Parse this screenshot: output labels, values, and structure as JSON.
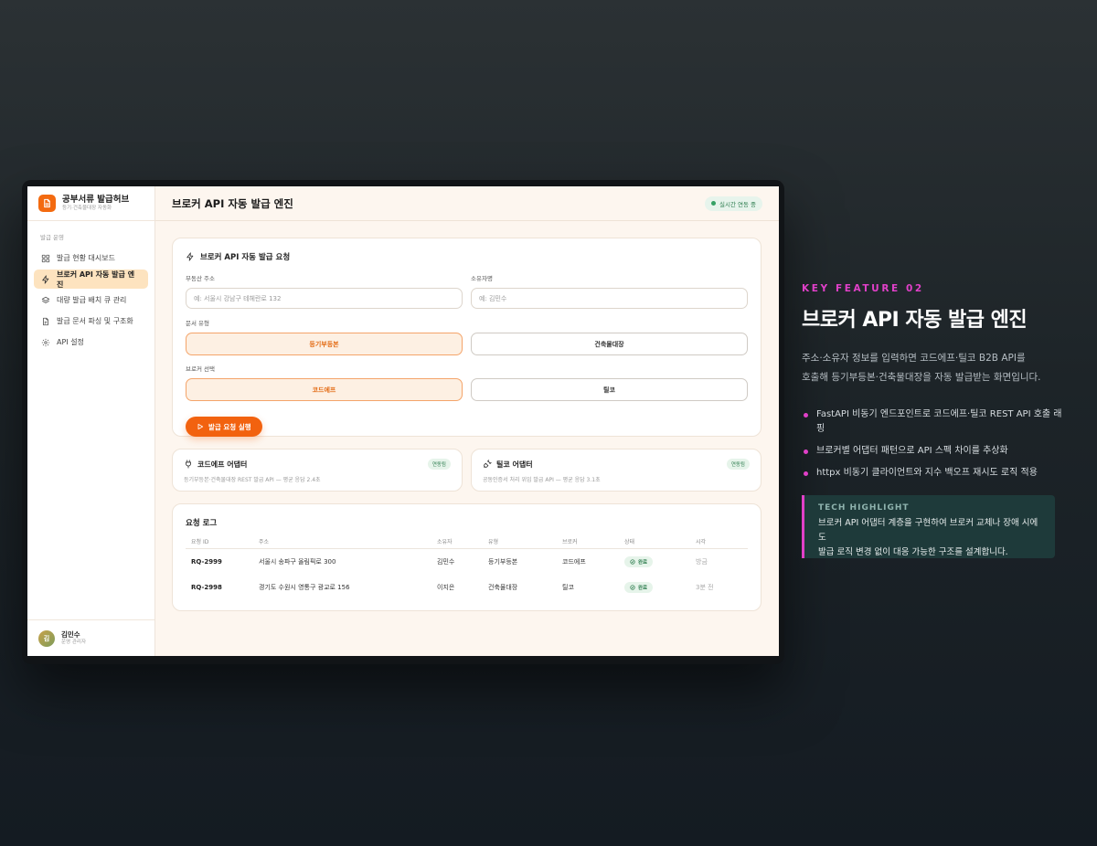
{
  "app": {
    "brand_title": "공부서류 발급허브",
    "brand_subtitle": "등기·건축물대장 자동화"
  },
  "sidebar": {
    "section_label": "발급 운영",
    "items": [
      {
        "label": "발급 현황 대시보드",
        "icon": "grid-icon"
      },
      {
        "label": "브로커 API 자동 발급 엔진",
        "icon": "lightning-icon",
        "active": true
      },
      {
        "label": "대량 발급 배치 큐 관리",
        "icon": "layers-icon"
      },
      {
        "label": "발급 문서 파싱 및 구조화",
        "icon": "document-icon"
      },
      {
        "label": "API 설정",
        "icon": "gear-icon"
      }
    ],
    "user": {
      "avatar_text": "김",
      "name": "김민수",
      "role": "운영 관리자"
    }
  },
  "header": {
    "title": "브로커 API 자동 발급 엔진",
    "live_badge": "실시간 연동 중"
  },
  "request_form": {
    "title": "브로커 API 자동 발급 요청",
    "address_label": "부동산 주소",
    "address_placeholder": "예: 서울시 강남구 테헤란로 132",
    "owner_label": "소유자명",
    "owner_placeholder": "예: 김민수",
    "doc_type_label": "문서 유형",
    "doc_types": [
      "등기부등본",
      "건축물대장"
    ],
    "broker_label": "브로커 선택",
    "brokers": [
      "코드에프",
      "틸코"
    ],
    "submit_label": "발급 요청 실행"
  },
  "adapters": [
    {
      "name": "코드에프 어댑터",
      "badge": "연동됨",
      "desc": "등기부등본·건축물대장 REST 발급 API — 평균 응답 2.4초"
    },
    {
      "name": "틸코 어댑터",
      "badge": "연동됨",
      "desc": "공동인증서 처리 위임 발급 API — 평균 응답 3.1초"
    }
  ],
  "log": {
    "title": "요청 로그",
    "columns": [
      "요청 ID",
      "주소",
      "소유자",
      "유형",
      "브로커",
      "상태",
      "시각"
    ],
    "rows": [
      {
        "id": "RQ-2999",
        "address": "서울시 송파구 올림픽로 300",
        "owner": "김민수",
        "type": "등기부등본",
        "broker": "코드에프",
        "status": "완료",
        "time": "방금"
      },
      {
        "id": "RQ-2998",
        "address": "경기도 수원시 영통구 광교로 156",
        "owner": "이지은",
        "type": "건축물대장",
        "broker": "틸코",
        "status": "완료",
        "time": "3분 전"
      }
    ]
  },
  "feature": {
    "kicker": "KEY FEATURE 02",
    "title": "브로커 API 자동 발급 엔진",
    "desc_line1": "주소·소유자 정보를 입력하면 코드에프·틸코 B2B API를",
    "desc_line2": "호출해 등기부등본·건축물대장을 자동 발급받는 화면입니다.",
    "bullets": [
      "FastAPI 비동기 엔드포인트로 코드에프·틸코 REST API 호출 래핑",
      "브로커별 어댑터 패턴으로 API 스펙 차이를 추상화",
      "httpx 비동기 클라이언트와 지수 백오프 재시도 로직 적용"
    ],
    "tech_title": "TECH HIGHLIGHT",
    "tech_line1": "브로커 API 어댑터 계층을 구현하여 브로커 교체나 장애 시에도",
    "tech_line2": "발급 로직 변경 없이 대응 가능한 구조를 설계합니다."
  },
  "colors": {
    "accent": "#f2620f",
    "magenta": "#e040c8",
    "success": "#2e7d4f"
  }
}
